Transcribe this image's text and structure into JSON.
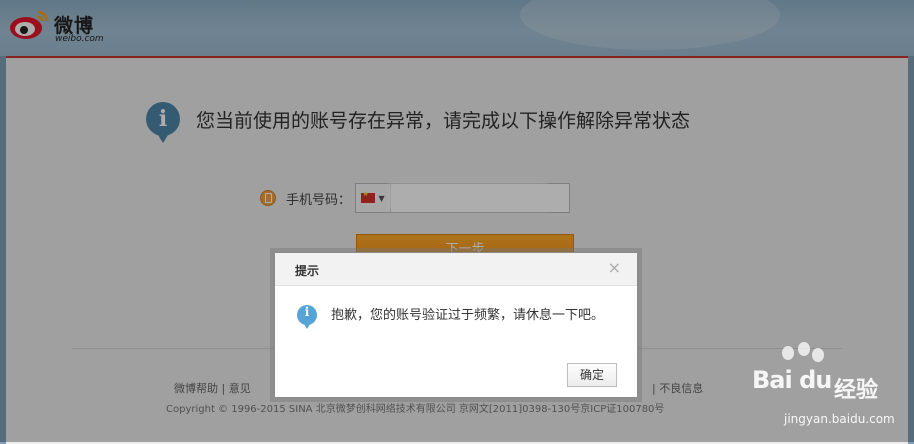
{
  "header": {
    "logo_text": "微博",
    "logo_sub": "weibo.com"
  },
  "main": {
    "headline": "您当前使用的账号存在异常，请完成以下操作解除异常状态",
    "phone_label": "手机号码：",
    "next_button": "下一步"
  },
  "footer": {
    "links_left": "微博帮助  |  意见",
    "links_right": "|  不良信息",
    "copyright": "Copyright © 1996-2015 SINA 北京微梦创科网络技术有限公司   京网文[2011]0398-130号京ICP证100780号"
  },
  "dialog": {
    "title": "提示",
    "close_icon": "×",
    "message": "抱歉，您的账号验证过于频繁，请休息一下吧。",
    "ok_button": "确定"
  },
  "watermark": {
    "brand": "Bai du",
    "brand_cn": "经验",
    "url": "jingyan.baidu.com"
  },
  "colors": {
    "accent_red": "#c9362e",
    "button_orange": "#f38f0e",
    "info_blue": "#4f86a8"
  }
}
